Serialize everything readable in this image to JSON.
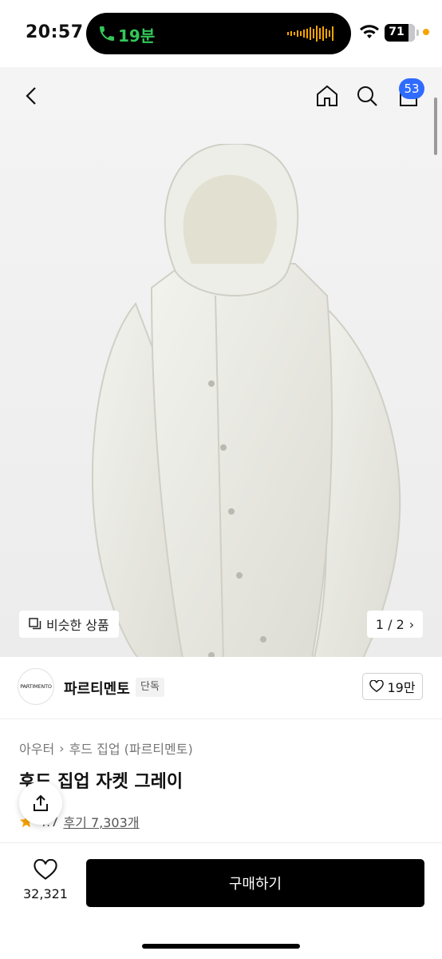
{
  "status": {
    "time": "20:57",
    "call_duration": "19분",
    "battery": "71"
  },
  "nav": {
    "cart_count": "53"
  },
  "gallery": {
    "similar_label": "비슷한 상품",
    "page_indicator": "1 / 2"
  },
  "brand": {
    "logo_text": "PARTIMENTO",
    "name": "파르티멘토",
    "tag": "단독",
    "likes": "19만"
  },
  "product": {
    "category_main": "아우터",
    "category_sub": "후드 집업 (파르티멘토)",
    "title": "후드 집업 자켓 그레이",
    "rating": "4.7",
    "reviews": "후기 7,303개"
  },
  "bottom": {
    "wish_count": "32,321",
    "buy_label": "구매하기"
  },
  "colors": {
    "accent_badge": "#2f6bff",
    "call_green": "#34c759",
    "star": "#f7a400"
  }
}
